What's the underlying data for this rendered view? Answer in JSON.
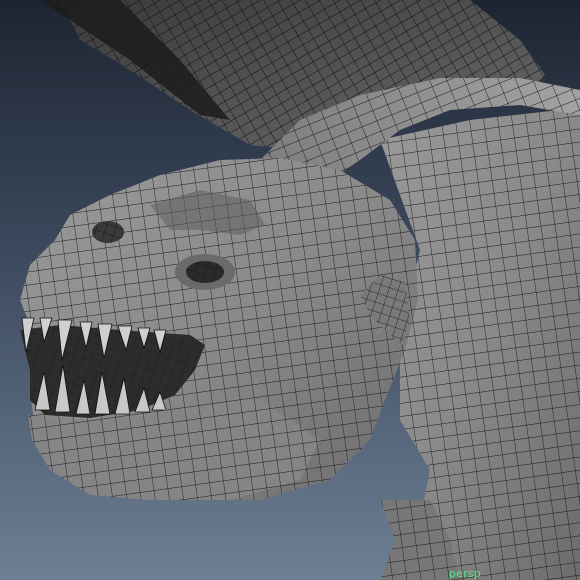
{
  "viewport": {
    "camera_label": "persp",
    "camera_label_color": "#58e08a",
    "background_colors": [
      "#1d2532",
      "#3d4b5f",
      "#6d7f94"
    ],
    "mesh_fill": "#8a8a8a",
    "wire_color": "#1a1a1a",
    "subject": "dragon-head-wireframe-mesh"
  }
}
